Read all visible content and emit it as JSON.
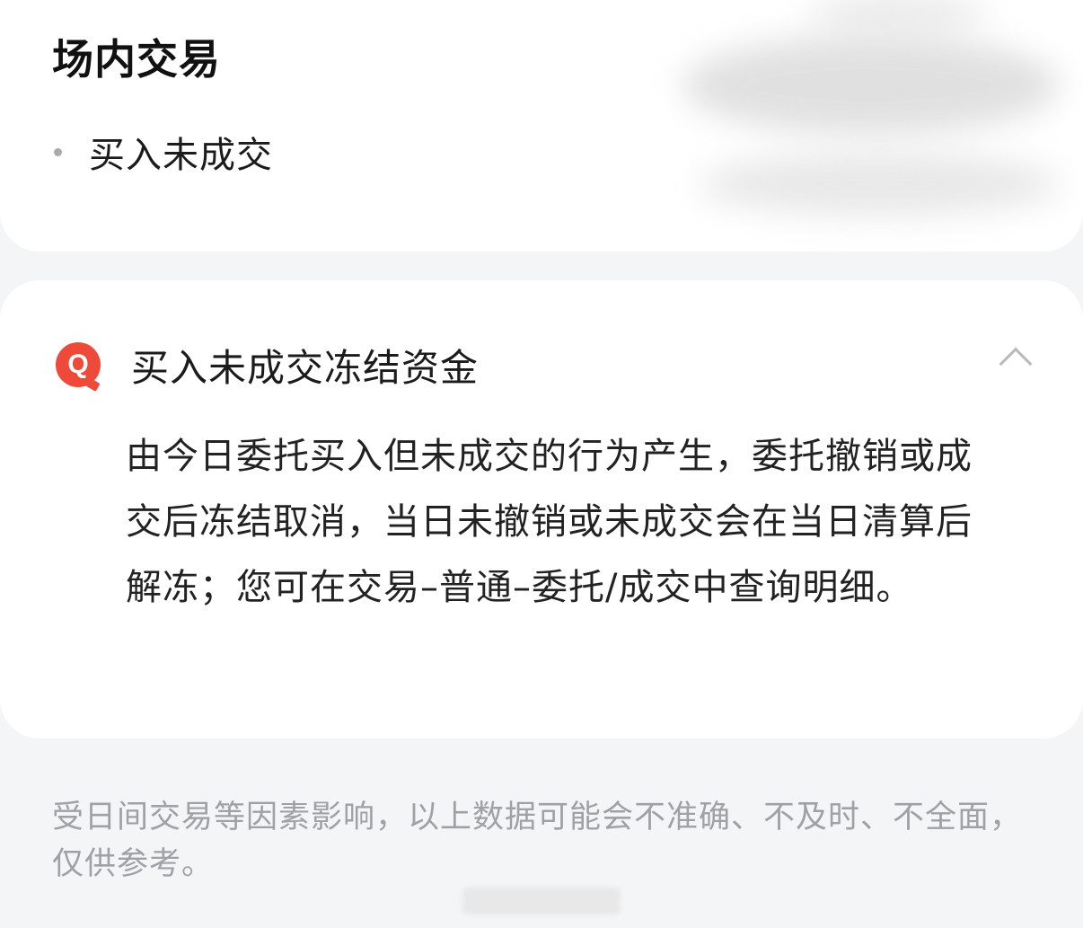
{
  "top_card": {
    "title": "场内交易",
    "items": [
      "买入未成交"
    ]
  },
  "faq": {
    "icon": "q-icon",
    "icon_letter": "Q",
    "question": "买入未成交冻结资金",
    "expanded": true,
    "answer": "由今日委托买入但未成交的行为产生，委托撤销或成交后冻结取消，当日未撤销或未成交会在当日清算后解冻；您可在交易–普通–委托/成交中查询明细。"
  },
  "footer": {
    "disclaimer": "受日间交易等因素影响，以上数据可能会不准确、不及时、不全面，仅供参考。"
  },
  "colors": {
    "accent_red": "#ee4a3a",
    "background": "#f4f5f7",
    "muted_text": "#9fa1a5"
  }
}
